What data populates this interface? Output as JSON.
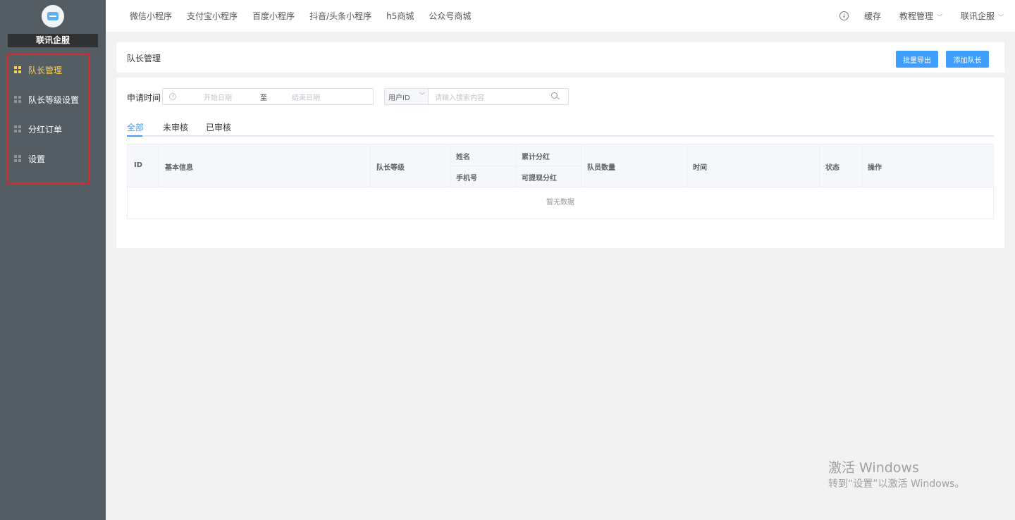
{
  "sidebar": {
    "brand": "联讯企服",
    "items": [
      {
        "label": "队长管理",
        "active": true
      },
      {
        "label": "队长等级设置",
        "active": false
      },
      {
        "label": "分红订单",
        "active": false
      },
      {
        "label": "设置",
        "active": false
      }
    ]
  },
  "topnav": {
    "links": [
      "微信小程序",
      "支付宝小程序",
      "百度小程序",
      "抖音/头条小程序",
      "h5商城",
      "公众号商城"
    ],
    "right": {
      "cache": "缓存",
      "tutorial": "教程管理",
      "account": "联讯企服"
    }
  },
  "header": {
    "title": "队长管理",
    "export_button": "批量导出",
    "add_button": "添加队长"
  },
  "filter": {
    "label": "申请时间",
    "start_placeholder": "开始日期",
    "separator": "至",
    "end_placeholder": "结束日期",
    "select_value": "用户ID",
    "search_placeholder": "请输入搜索内容"
  },
  "tabs": [
    "全部",
    "未审核",
    "已审核"
  ],
  "table": {
    "col_id": "ID",
    "col_basic": "基本信息",
    "col_level": "队长等级",
    "col_name": "姓名",
    "col_phone": "手机号",
    "col_total": "累计分红",
    "col_withdraw": "可提现分红",
    "col_members": "队员数量",
    "col_time": "时间",
    "col_status": "状态",
    "col_action": "操作",
    "empty_text": "暂无数据"
  },
  "watermark": {
    "line1": "激活 Windows",
    "line2": "转到“设置”以激活 Windows。"
  },
  "colors": {
    "sidebar_bg": "#545c64",
    "active_menu": "#ffd04b",
    "primary": "#409eff",
    "highlight_box": "#e3242b"
  }
}
